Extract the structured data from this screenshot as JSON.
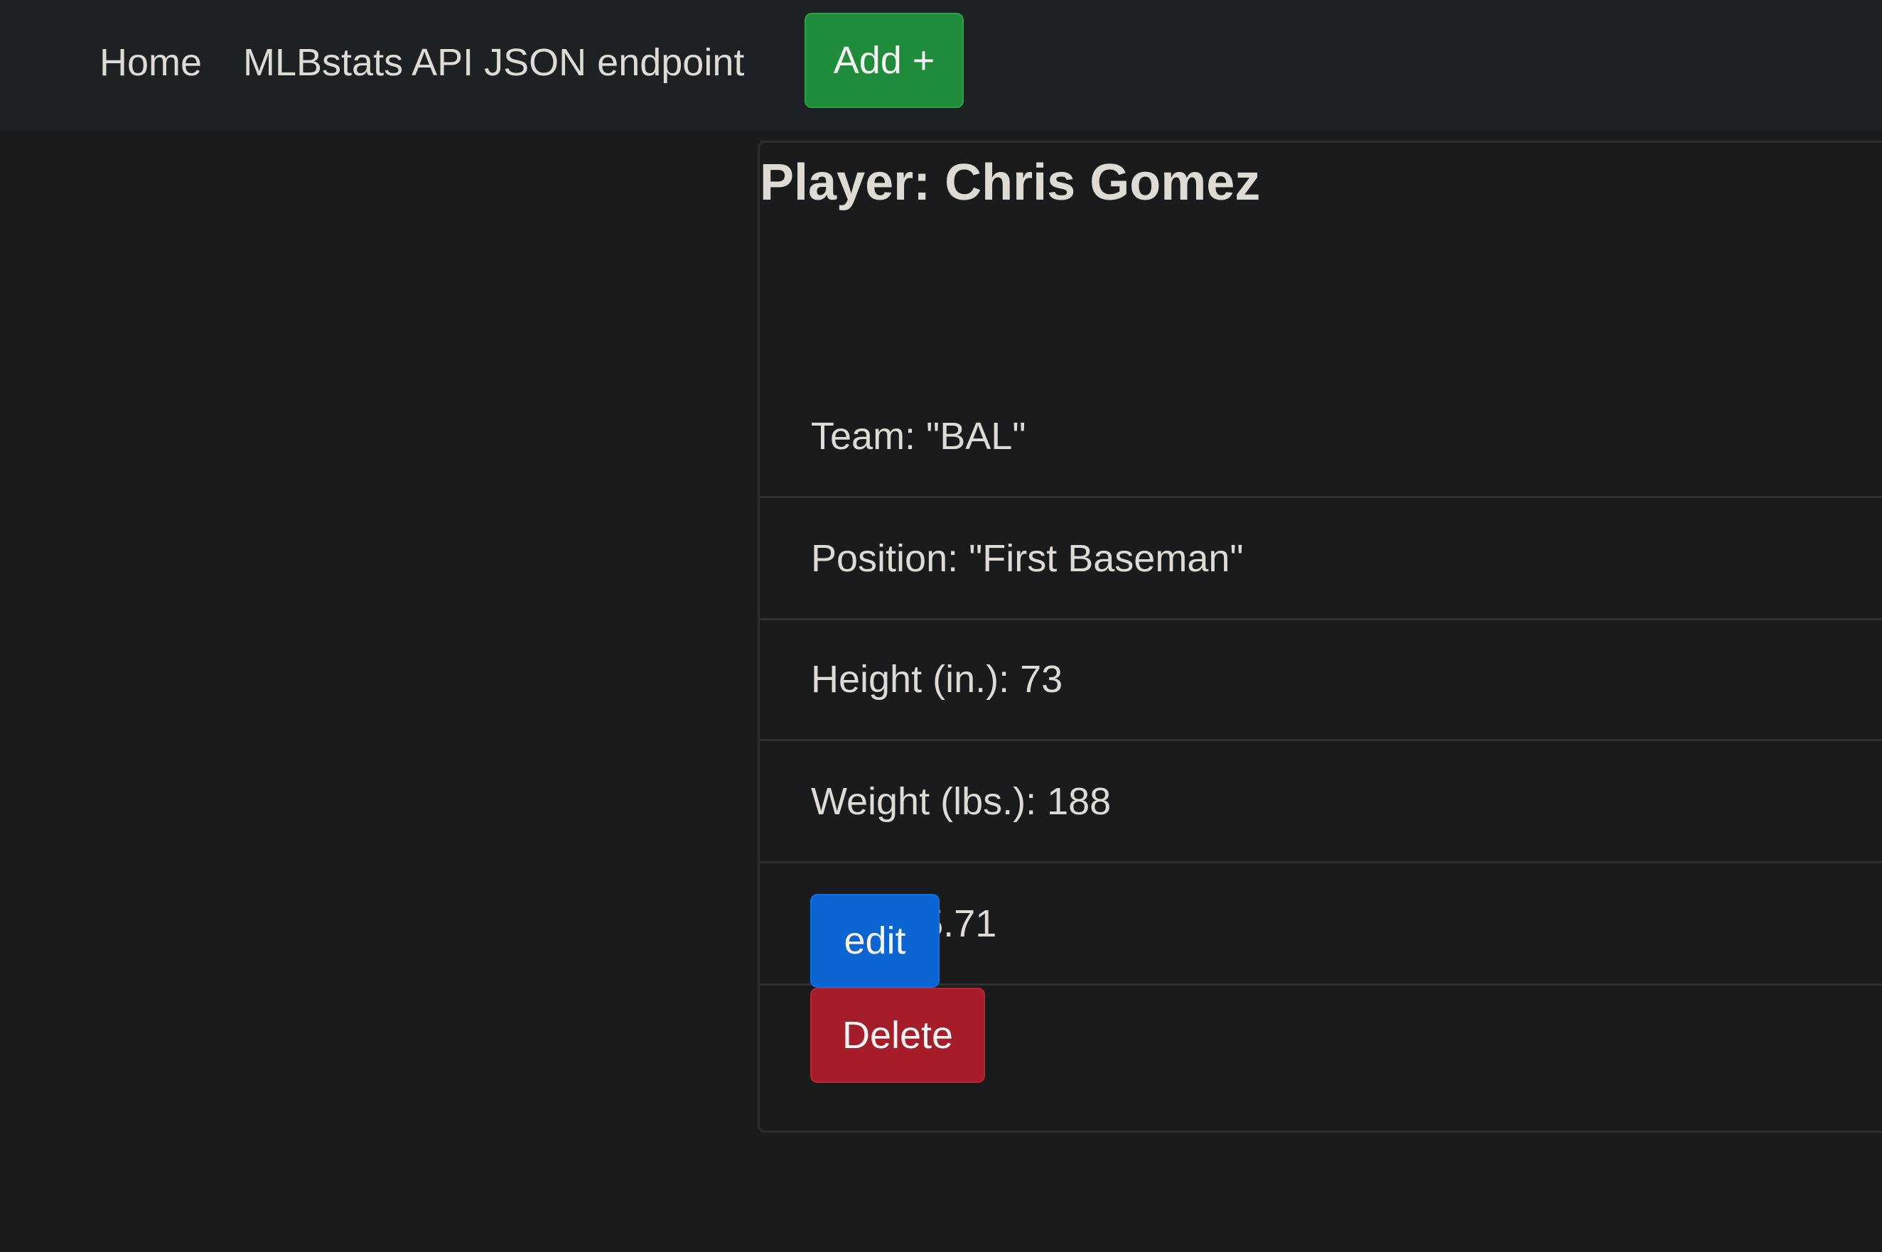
{
  "nav": {
    "home": "Home",
    "api": "MLBstats API JSON endpoint",
    "add_label": "Add +"
  },
  "player": {
    "title": "Player: Chris Gomez",
    "fields": [
      "Team: \"BAL\"",
      "Position: \"First Baseman\"",
      "Height (in.): 73",
      "Weight (lbs.): 188",
      "Age: 35.71"
    ]
  },
  "actions": {
    "edit_label": "edit",
    "delete_label": "Delete"
  },
  "colors": {
    "background": "#1a1b1d",
    "navbar": "#1e2124",
    "add": "#1f8c3a",
    "edit": "#0a64d2",
    "delete": "#a51c2a",
    "text": "#dedad4"
  }
}
